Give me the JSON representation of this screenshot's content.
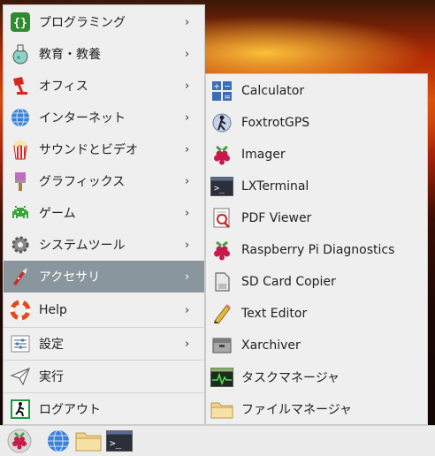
{
  "main_menu": {
    "items": [
      {
        "label": "プログラミング",
        "icon": "programming-icon",
        "has_submenu": true
      },
      {
        "label": "教育・教養",
        "icon": "education-flask-icon",
        "has_submenu": true
      },
      {
        "label": "オフィス",
        "icon": "office-lamp-icon",
        "has_submenu": true
      },
      {
        "label": "インターネット",
        "icon": "globe-icon",
        "has_submenu": true
      },
      {
        "label": "サウンドとビデオ",
        "icon": "popcorn-icon",
        "has_submenu": true
      },
      {
        "label": "グラフィックス",
        "icon": "paintbrush-icon",
        "has_submenu": true
      },
      {
        "label": "ゲーム",
        "icon": "space-invader-icon",
        "has_submenu": true
      },
      {
        "label": "システムツール",
        "icon": "gear-icon",
        "has_submenu": true
      },
      {
        "label": "アクセサリ",
        "icon": "pocket-knife-icon",
        "has_submenu": true,
        "selected": true
      },
      {
        "label": "Help",
        "icon": "lifebuoy-icon",
        "has_submenu": true
      },
      {
        "label": "設定",
        "icon": "settings-sliders-icon",
        "has_submenu": true
      },
      {
        "label": "実行",
        "icon": "paper-plane-icon",
        "has_submenu": false
      },
      {
        "label": "ログアウト",
        "icon": "exit-icon",
        "has_submenu": false
      }
    ],
    "arrow": "›"
  },
  "submenu": {
    "items": [
      {
        "label": "Calculator",
        "icon": "calculator-icon"
      },
      {
        "label": "FoxtrotGPS",
        "icon": "foxtrotgps-icon"
      },
      {
        "label": "Imager",
        "icon": "raspberry-icon"
      },
      {
        "label": "LXTerminal",
        "icon": "terminal-icon"
      },
      {
        "label": "PDF Viewer",
        "icon": "pdf-viewer-icon"
      },
      {
        "label": "Raspberry Pi Diagnostics",
        "icon": "raspberry-icon"
      },
      {
        "label": "SD Card Copier",
        "icon": "sd-card-icon"
      },
      {
        "label": "Text Editor",
        "icon": "pencil-icon"
      },
      {
        "label": "Xarchiver",
        "icon": "archive-icon"
      },
      {
        "label": "タスクマネージャ",
        "icon": "task-manager-icon"
      },
      {
        "label": "ファイルマネージャ",
        "icon": "folder-icon"
      }
    ]
  },
  "taskbar": {
    "buttons": [
      "raspberry-menu-icon",
      "web-browser-icon",
      "file-manager-icon",
      "terminal-icon"
    ]
  },
  "colors": {
    "selected": "#8a969d",
    "menu_bg": "#efefef",
    "accent_raspberry": "#c51a4a"
  }
}
